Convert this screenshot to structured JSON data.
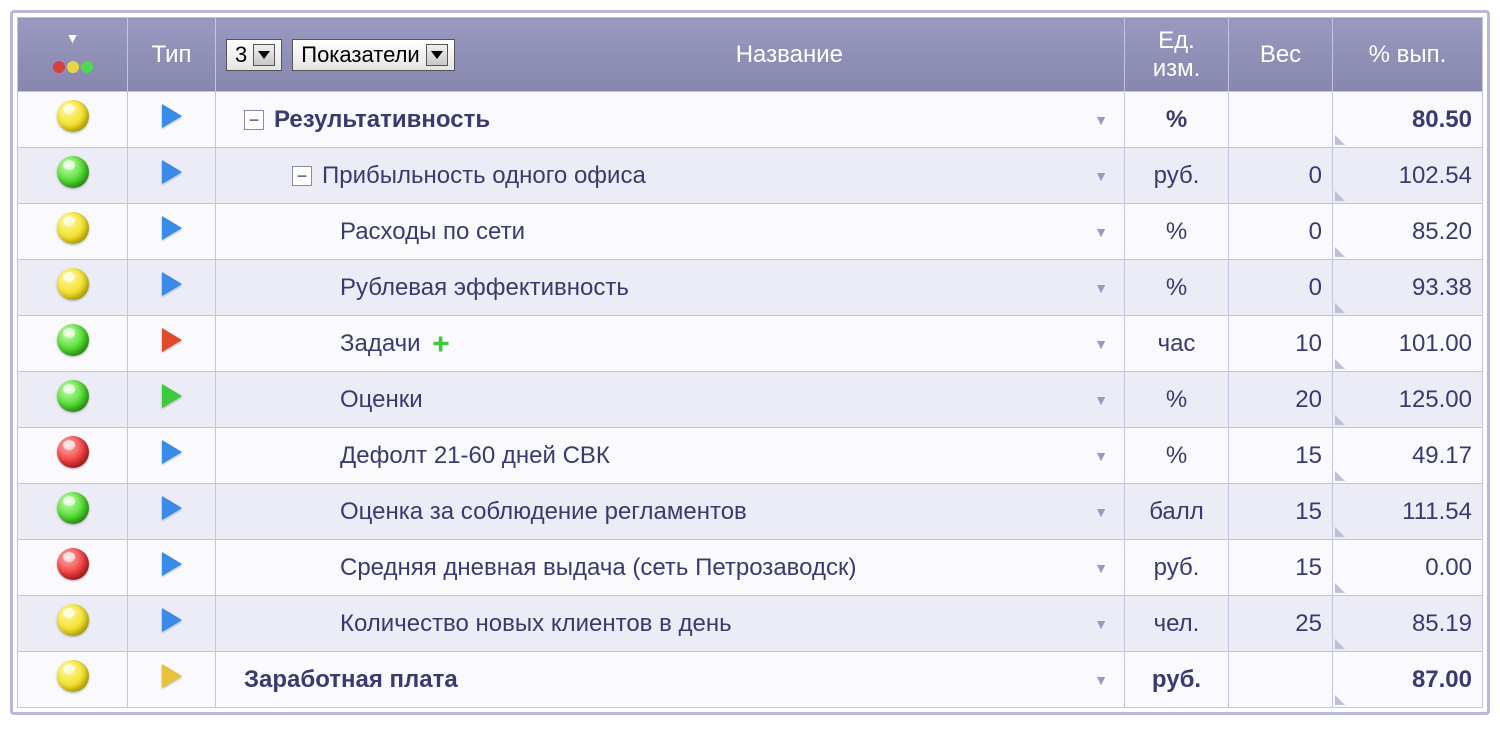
{
  "header": {
    "type": "Тип",
    "name": "Название",
    "unit": "Ед. изм.",
    "weight": "Вес",
    "pct": "% вып.",
    "level_select": "3",
    "filter_select": "Показатели"
  },
  "rows": [
    {
      "status": "yellow",
      "type": "blue",
      "indent": 0,
      "expander": "minus",
      "plus": false,
      "bold": true,
      "name": "Результативность",
      "unit": "%",
      "weight": "",
      "pct": "80.50"
    },
    {
      "status": "green",
      "type": "blue",
      "indent": 1,
      "expander": "minus",
      "plus": false,
      "bold": false,
      "name": "Прибыльность одного офиса",
      "unit": "руб.",
      "weight": "0",
      "pct": "102.54"
    },
    {
      "status": "yellow",
      "type": "blue",
      "indent": 2,
      "expander": "",
      "plus": false,
      "bold": false,
      "name": "Расходы по сети",
      "unit": "%",
      "weight": "0",
      "pct": "85.20"
    },
    {
      "status": "yellow",
      "type": "blue",
      "indent": 2,
      "expander": "",
      "plus": false,
      "bold": false,
      "name": "Рублевая эффективность",
      "unit": "%",
      "weight": "0",
      "pct": "93.38"
    },
    {
      "status": "green",
      "type": "red",
      "indent": 2,
      "expander": "",
      "plus": true,
      "bold": false,
      "name": "Задачи",
      "unit": "час",
      "weight": "10",
      "pct": "101.00"
    },
    {
      "status": "green",
      "type": "green",
      "indent": 2,
      "expander": "",
      "plus": false,
      "bold": false,
      "name": "Оценки",
      "unit": "%",
      "weight": "20",
      "pct": "125.00"
    },
    {
      "status": "red",
      "type": "blue",
      "indent": 2,
      "expander": "",
      "plus": false,
      "bold": false,
      "name": "Дефолт 21-60 дней СВК",
      "unit": "%",
      "weight": "15",
      "pct": "49.17"
    },
    {
      "status": "green",
      "type": "blue",
      "indent": 2,
      "expander": "",
      "plus": false,
      "bold": false,
      "name": "Оценка за соблюдение регламентов",
      "unit": "балл",
      "weight": "15",
      "pct": "111.54"
    },
    {
      "status": "red",
      "type": "blue",
      "indent": 2,
      "expander": "",
      "plus": false,
      "bold": false,
      "name": "Средняя дневная выдача (сеть Петрозаводск)",
      "unit": "руб.",
      "weight": "15",
      "pct": "0.00"
    },
    {
      "status": "yellow",
      "type": "blue",
      "indent": 2,
      "expander": "",
      "plus": false,
      "bold": false,
      "name": "Количество новых клиентов в день",
      "unit": "чел.",
      "weight": "25",
      "pct": "85.19"
    },
    {
      "status": "yellow",
      "type": "amber",
      "indent": 0,
      "expander": "",
      "plus": false,
      "bold": true,
      "name": "Заработная плата",
      "unit": "руб.",
      "weight": "",
      "pct": "87.00"
    }
  ]
}
